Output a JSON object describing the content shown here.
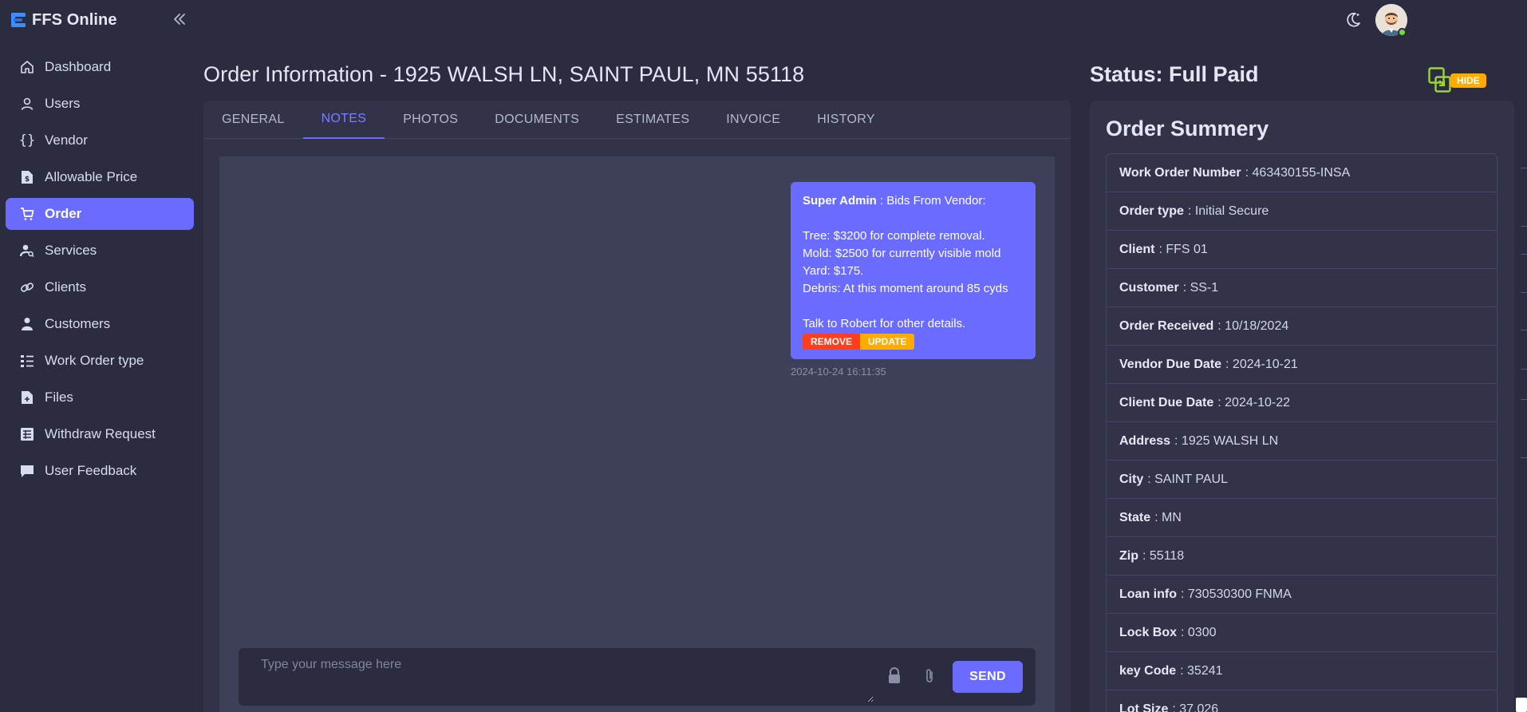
{
  "app": {
    "name": "FFS Online",
    "brand_color": "#696cff"
  },
  "sidebar": {
    "items": [
      {
        "label": "Dashboard",
        "icon": "home-icon"
      },
      {
        "label": "Users",
        "icon": "user-icon"
      },
      {
        "label": "Vendor",
        "icon": "braces-icon"
      },
      {
        "label": "Allowable Price",
        "icon": "file-dollar-icon"
      },
      {
        "label": "Order",
        "icon": "cart-icon",
        "active": true
      },
      {
        "label": "Services",
        "icon": "user-search-icon"
      },
      {
        "label": "Clients",
        "icon": "chain-icon"
      },
      {
        "label": "Customers",
        "icon": "person-icon"
      },
      {
        "label": "Work Order type",
        "icon": "list-icon"
      },
      {
        "label": "Files",
        "icon": "file-icon"
      },
      {
        "label": "Withdraw Request",
        "icon": "table-icon"
      },
      {
        "label": "User Feedback",
        "icon": "comment-icon"
      }
    ]
  },
  "page": {
    "title": "Order Information - 1925 WALSH LN, SAINT PAUL, MN 55118",
    "status": "Status: Full Paid",
    "hide_label": "HIDE"
  },
  "tabs": [
    {
      "label": "GENERAL"
    },
    {
      "label": "NOTES",
      "active": true
    },
    {
      "label": "PHOTOS"
    },
    {
      "label": "DOCUMENTS"
    },
    {
      "label": "ESTIMATES"
    },
    {
      "label": "INVOICE"
    },
    {
      "label": "HISTORY"
    }
  ],
  "note": {
    "author": "Super Admin",
    "lines": [
      " : Bids From Vendor:",
      "",
      "Tree: $3200 for complete removal.",
      "Mold: $2500 for currently visible mold",
      "Yard: $175.",
      "Debris: At this moment around 85 cyds",
      "",
      "Talk to Robert for other details."
    ],
    "remove_label": "REMOVE",
    "update_label": "UPDATE",
    "timestamp": "2024-10-24 16:11:35"
  },
  "composer": {
    "placeholder": "Type your message here",
    "send_label": "SEND"
  },
  "summary": {
    "title": "Order Summery",
    "rows": [
      {
        "label": "Work Order Number",
        "value": "463430155-INSA"
      },
      {
        "label": "Order type",
        "value": "Initial Secure"
      },
      {
        "label": "Client",
        "value": "FFS 01"
      },
      {
        "label": "Customer",
        "value": "SS-1"
      },
      {
        "label": "Order Received",
        "value": "10/18/2024"
      },
      {
        "label": "Vendor Due Date",
        "value": "2024-10-21"
      },
      {
        "label": "Client Due Date",
        "value": "2024-10-22"
      },
      {
        "label": "Address",
        "value": "1925 WALSH LN"
      },
      {
        "label": "City",
        "value": "SAINT PAUL"
      },
      {
        "label": "State",
        "value": "MN"
      },
      {
        "label": "Zip",
        "value": "55118"
      },
      {
        "label": "Loan info",
        "value": "730530300 FNMA"
      },
      {
        "label": "Lock Box",
        "value": "0300"
      },
      {
        "label": "key Code",
        "value": "35241"
      },
      {
        "label": "Lot Size",
        "value": "37,026"
      }
    ]
  }
}
